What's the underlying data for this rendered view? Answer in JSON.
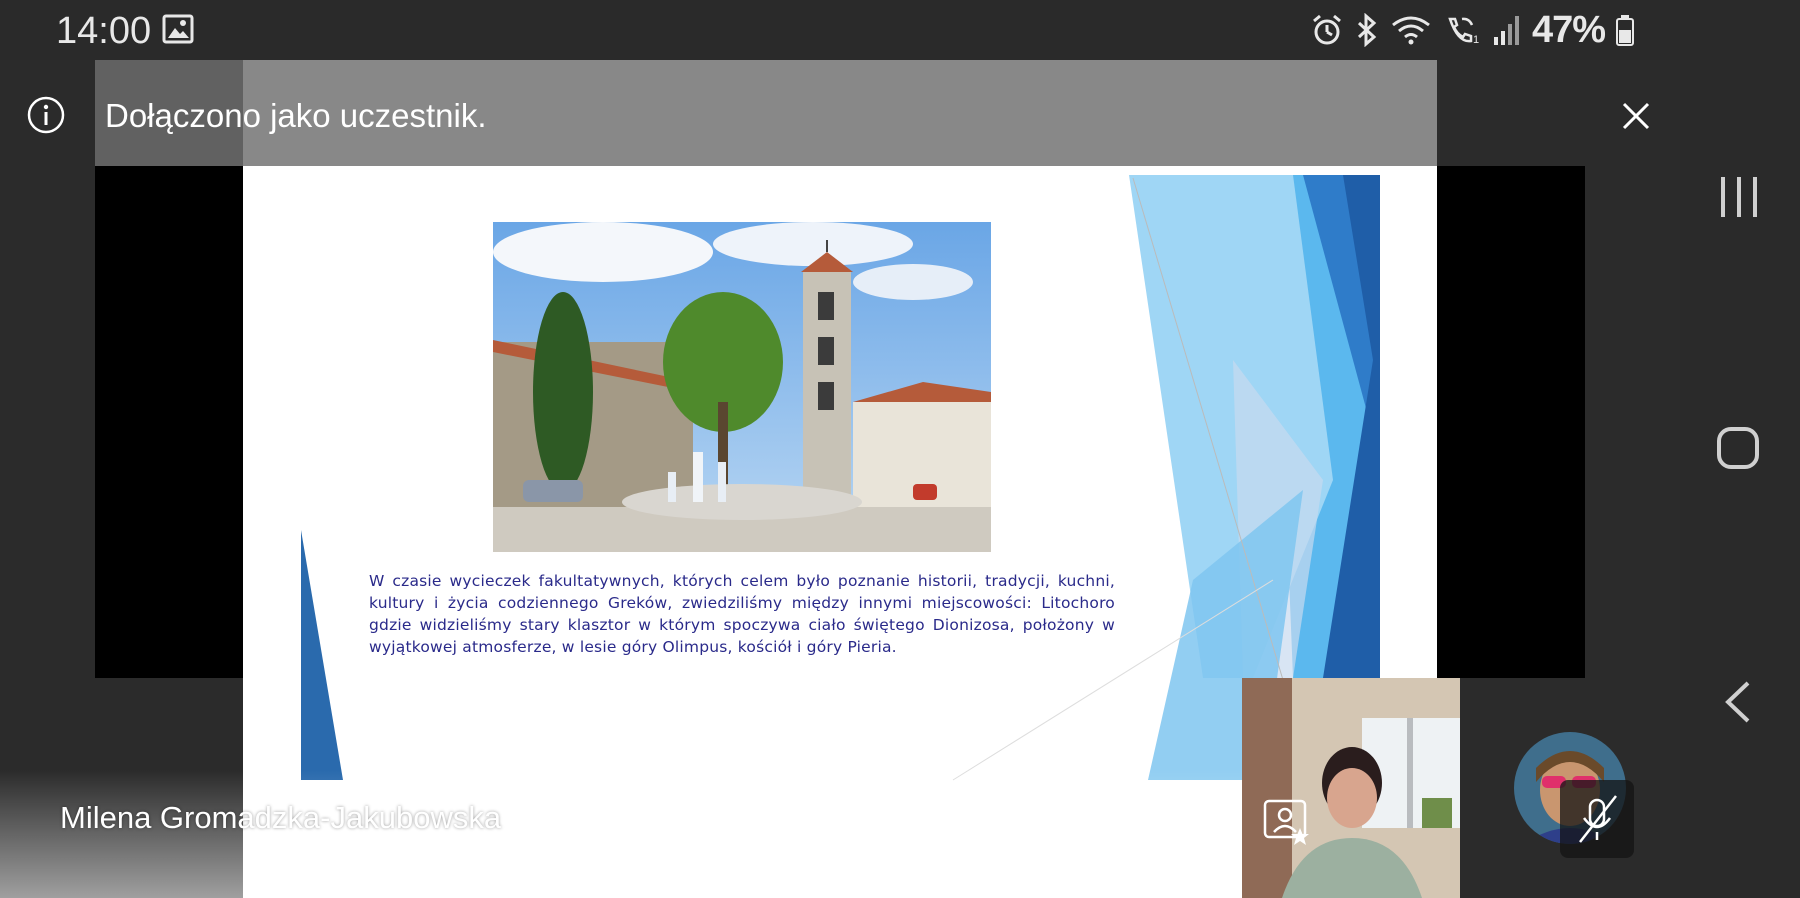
{
  "status_bar": {
    "time": "14:00",
    "battery": "47%",
    "icons": [
      "gallery-icon",
      "alarm-icon",
      "bluetooth-icon",
      "wifi-icon",
      "wifi-calling-icon",
      "signal-icon",
      "battery-icon"
    ]
  },
  "banner": {
    "message": "Dołączono jako uczestnik.",
    "icon": "info-icon",
    "close_icon": "close-icon"
  },
  "slide": {
    "body_text": "W czasie wycieczek fakultatywnych, których celem było poznanie historii, tradycji, kuchni, kultury i życia codziennego Greków, zwiedziliśmy między innymi miejscowości: Litochoro gdzie widzieliśmy stary klasztor w którym spoczywa ciało świętego Dionizosa, położony w wyjątkowej atmosferze, w lesie góry Olimpus, kościół i góry Pieria.",
    "accent_colors": [
      "#1f5ea8",
      "#5bb8ee",
      "#9fd6f5",
      "#2f7cc9"
    ]
  },
  "presenter": {
    "name": "Milena Gromadzka-Jakubowska",
    "icon": "presenter-icon"
  },
  "participants": {
    "video_icon": "presenter-icon",
    "avatar_mute_icon": "mic-off-icon"
  },
  "navigation": {
    "items": [
      "recents-icon",
      "home-icon",
      "back-icon"
    ]
  }
}
